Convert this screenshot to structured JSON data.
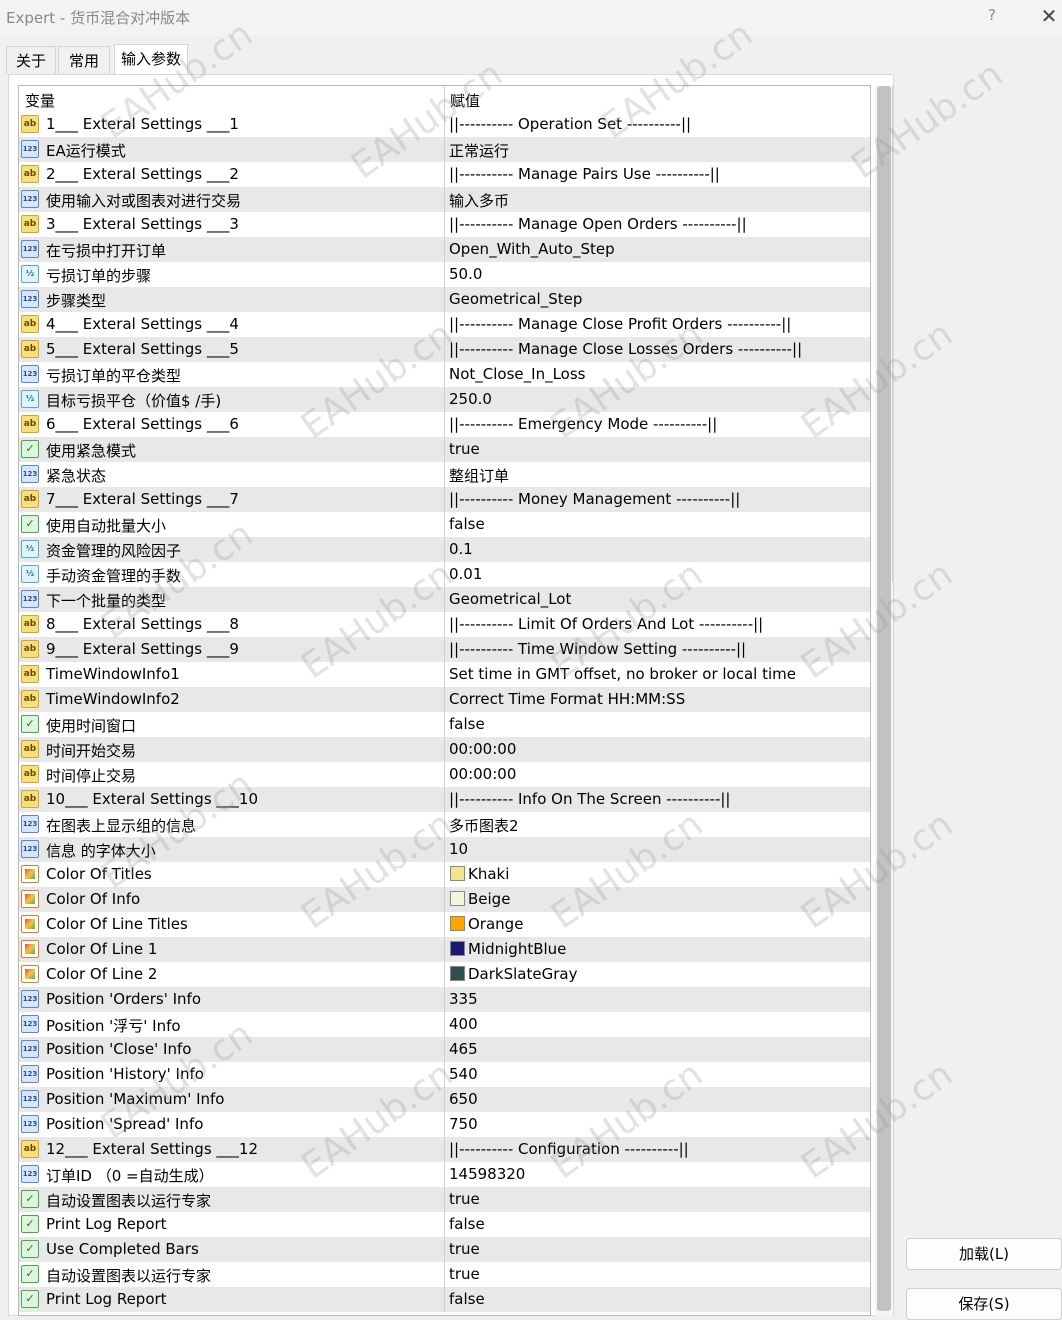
{
  "window": {
    "title": "Expert - 货币混合对冲版本",
    "help": "?",
    "close": "✕"
  },
  "tabs": [
    {
      "label": "关于"
    },
    {
      "label": "常用"
    },
    {
      "label": "输入参数",
      "active": true
    }
  ],
  "table": {
    "headers": {
      "variable": "变量",
      "value": "赋值"
    },
    "rows": [
      {
        "type": "ab",
        "name": "1___ Exteral Settings ___1",
        "value": "||---------- Operation Set ----------||"
      },
      {
        "type": "123",
        "name": "EA运行模式",
        "value": "正常运行"
      },
      {
        "type": "ab",
        "name": "2___ Exteral Settings ___2",
        "value": "||---------- Manage Pairs Use ----------||"
      },
      {
        "type": "123",
        "name": "使用输入对或图表对进行交易",
        "value": "输入多币"
      },
      {
        "type": "ab",
        "name": "3___ Exteral Settings ___3",
        "value": "||---------- Manage Open Orders ----------||"
      },
      {
        "type": "123",
        "name": "在亏损中打开订单",
        "value": "Open_With_Auto_Step"
      },
      {
        "type": "half",
        "name": "亏损订单的步骤",
        "value": "50.0"
      },
      {
        "type": "123",
        "name": "步骤类型",
        "value": "Geometrical_Step"
      },
      {
        "type": "ab",
        "name": "4___ Exteral Settings ___4",
        "value": "||---------- Manage Close Profit Orders ----------||"
      },
      {
        "type": "ab",
        "name": "5___ Exteral Settings ___5",
        "value": "||---------- Manage Close Losses Orders ----------||"
      },
      {
        "type": "123",
        "name": "亏损订单的平仓类型",
        "value": "Not_Close_In_Loss"
      },
      {
        "type": "half",
        "name": "目标亏损平仓（价值$ /手)",
        "value": "250.0"
      },
      {
        "type": "ab",
        "name": "6___ Exteral Settings ___6",
        "value": "||---------- Emergency Mode ----------||"
      },
      {
        "type": "bool",
        "name": "使用紧急模式",
        "value": "true"
      },
      {
        "type": "123",
        "name": "紧急状态",
        "value": "整组订单"
      },
      {
        "type": "ab",
        "name": "7___ Exteral Settings ___7",
        "value": "||---------- Money Management ----------||"
      },
      {
        "type": "bool",
        "name": "使用自动批量大小",
        "value": "false"
      },
      {
        "type": "half",
        "name": "资金管理的风险因子",
        "value": "0.1"
      },
      {
        "type": "half",
        "name": "手动资金管理的手数",
        "value": "0.01"
      },
      {
        "type": "123",
        "name": "下一个批量的类型",
        "value": "Geometrical_Lot"
      },
      {
        "type": "ab",
        "name": "8___ Exteral Settings ___8",
        "value": "||---------- Limit Of Orders And Lot ----------||"
      },
      {
        "type": "ab",
        "name": "9___ Exteral Settings ___9",
        "value": "||---------- Time Window Setting ----------||"
      },
      {
        "type": "ab",
        "name": "TimeWindowInfo1",
        "value": "Set time in GMT offset, no broker or local time"
      },
      {
        "type": "ab",
        "name": "TimeWindowInfo2",
        "value": "Correct Time Format HH:MM:SS"
      },
      {
        "type": "bool",
        "name": "使用时间窗口",
        "value": "false"
      },
      {
        "type": "ab",
        "name": "时间开始交易",
        "value": "00:00:00"
      },
      {
        "type": "ab",
        "name": "时间停止交易",
        "value": "00:00:00"
      },
      {
        "type": "ab",
        "name": "10___ Exteral Settings ___10",
        "value": "||---------- Info On The Screen ----------||"
      },
      {
        "type": "123",
        "name": "在图表上显示组的信息",
        "value": "多币图表2"
      },
      {
        "type": "123",
        "name": "信息 的字体大小",
        "value": "10"
      },
      {
        "type": "color",
        "name": "Color Of Titles",
        "value": "Khaki",
        "swatch": "#f0e68c"
      },
      {
        "type": "color",
        "name": "Color Of Info",
        "value": "Beige",
        "swatch": "#f5f5dc"
      },
      {
        "type": "color",
        "name": "Color Of Line Titles",
        "value": "Orange",
        "swatch": "#ffa500"
      },
      {
        "type": "color",
        "name": "Color Of Line 1",
        "value": "MidnightBlue",
        "swatch": "#191970"
      },
      {
        "type": "color",
        "name": "Color Of Line 2",
        "value": "DarkSlateGray",
        "swatch": "#2f4f4f"
      },
      {
        "type": "123",
        "name": "Position 'Orders' Info",
        "value": "335"
      },
      {
        "type": "123",
        "name": "Position '浮亏' Info",
        "value": "400"
      },
      {
        "type": "123",
        "name": "Position 'Close' Info",
        "value": "465"
      },
      {
        "type": "123",
        "name": "Position 'History' Info",
        "value": "540"
      },
      {
        "type": "123",
        "name": "Position 'Maximum' Info",
        "value": "650"
      },
      {
        "type": "123",
        "name": "Position 'Spread' Info",
        "value": "750"
      },
      {
        "type": "ab",
        "name": "12___ Exteral Settings ___12",
        "value": "||---------- Configuration ----------||"
      },
      {
        "type": "123",
        "name": "订单ID （0 =自动生成）",
        "value": "14598320"
      },
      {
        "type": "bool",
        "name": "自动设置图表以运行专家",
        "value": "true"
      },
      {
        "type": "bool",
        "name": "Print Log Report",
        "value": "false"
      },
      {
        "type": "bool",
        "name": "Use Completed Bars",
        "value": "true"
      },
      {
        "type": "bool",
        "name": "自动设置图表以运行专家",
        "value": "true"
      },
      {
        "type": "bool",
        "name": "Print Log Report",
        "value": "false"
      }
    ]
  },
  "buttons": {
    "load": "加载(L)",
    "save": "保存(S)"
  },
  "icon_glyphs": {
    "ab": "ab",
    "123": "123",
    "half": "½",
    "bool": "✓",
    "color": ""
  },
  "watermark": "EAHub.cn"
}
